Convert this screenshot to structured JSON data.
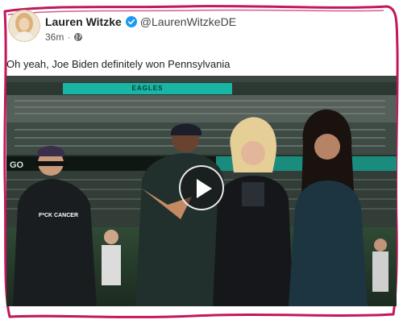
{
  "author": {
    "display_name": "Lauren Witzke",
    "handle": "@LaurenWitzkeDE",
    "verified": true,
    "avatar_icon": "profile-photo"
  },
  "meta": {
    "timestamp": "36m",
    "separator": "·",
    "visibility_icon": "globe-icon"
  },
  "post": {
    "text": "Oh yeah, Joe Biden definitely won Pennsylvania"
  },
  "media": {
    "type": "video",
    "play_icon": "play-icon",
    "scene_text": {
      "banner": "EAGLES",
      "side_banner": "GO",
      "shirt": "F*CK CANCER"
    }
  },
  "colors": {
    "border_doodle": "#c2185b",
    "verified_blue": "#1d9bf0",
    "banner_teal": "#19b6a6"
  }
}
